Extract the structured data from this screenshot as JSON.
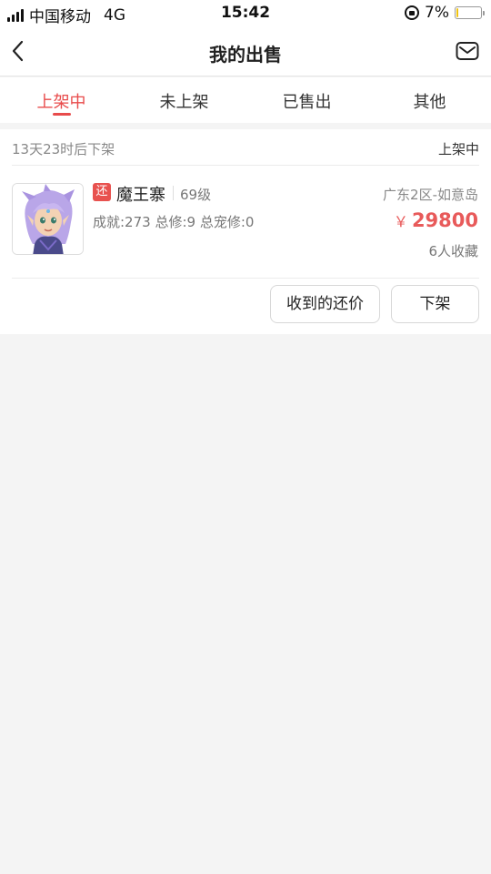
{
  "status_bar": {
    "carrier": "中国移动",
    "network": "4G",
    "time": "15:42",
    "battery": "7%",
    "battery_level": 0.07
  },
  "nav": {
    "title": "我的出售",
    "back_icon": "chevron-left-icon",
    "mail_icon": "mail-icon"
  },
  "tabs": [
    {
      "label": "上架中",
      "active": true
    },
    {
      "label": "未上架",
      "active": false
    },
    {
      "label": "已售出",
      "active": false
    },
    {
      "label": "其他",
      "active": false
    }
  ],
  "listing": {
    "countdown": "13天23时后下架",
    "status": "上架中",
    "tag": "还",
    "name": "魔王寨",
    "level": "69级",
    "stats": "成就:273 总修:9 总宠修:0",
    "server": "广东2区-如意岛",
    "currency": "￥",
    "price": "29800",
    "favorites": "6人收藏",
    "offers_button": "收到的还价",
    "delist_button": "下架"
  },
  "colors": {
    "accent": "#e84b4b",
    "background": "#f4f4f4"
  }
}
